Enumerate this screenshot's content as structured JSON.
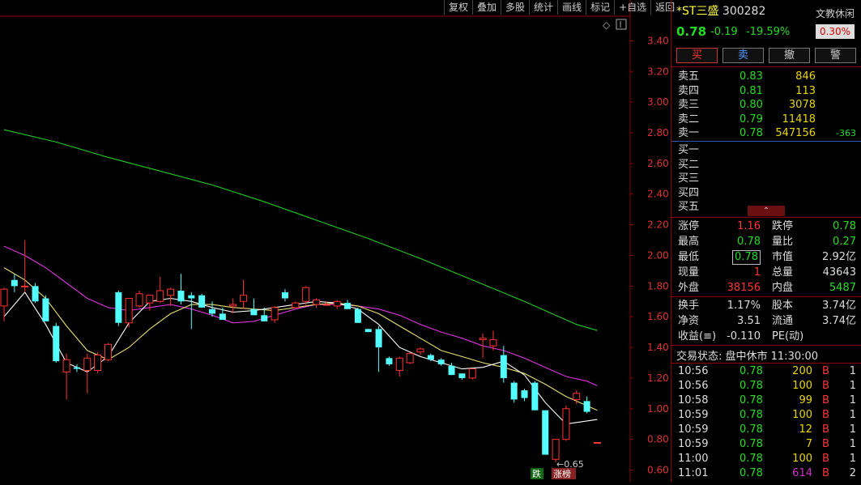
{
  "colors": {
    "up": "#ff3333",
    "down": "#54ffff",
    "ma5": "#ffffff",
    "ma10": "#e8e070",
    "ma20": "#dd33dd",
    "ma60": "#22cc22",
    "axis": "#8b0000"
  },
  "toolbar": [
    "复权",
    "叠加",
    "多股",
    "统计",
    "画线",
    "标记",
    "+自选",
    "返回"
  ],
  "chart": {
    "y_ticks": [
      "3.40",
      "3.20",
      "3.00",
      "2.80",
      "2.60",
      "2.40",
      "2.20",
      "2.00",
      "1.80",
      "1.60",
      "1.40",
      "1.20",
      "1.00",
      "0.80",
      "0.60"
    ],
    "low_label": "←0.65",
    "tag_down": "跌",
    "tag_limit": "涨榜",
    "corner_icon": "diamond-icon"
  },
  "chart_data": {
    "type": "candlestick",
    "ylim": [
      0.55,
      3.55
    ],
    "candles": [
      {
        "o": 1.67,
        "h": 1.79,
        "l": 1.57,
        "c": 1.78
      },
      {
        "o": 1.84,
        "h": 1.88,
        "l": 1.76,
        "c": 1.8
      },
      {
        "o": 1.8,
        "h": 2.1,
        "l": 1.76,
        "c": 1.8
      },
      {
        "o": 1.8,
        "h": 1.82,
        "l": 1.69,
        "c": 1.7
      },
      {
        "o": 1.72,
        "h": 1.74,
        "l": 1.57,
        "c": 1.57
      },
      {
        "o": 1.54,
        "h": 1.56,
        "l": 1.3,
        "c": 1.31
      },
      {
        "o": 1.24,
        "h": 1.36,
        "l": 1.06,
        "c": 1.32
      },
      {
        "o": 1.27,
        "h": 1.29,
        "l": 1.24,
        "c": 1.26
      },
      {
        "o": 1.25,
        "h": 1.36,
        "l": 1.1,
        "c": 1.33
      },
      {
        "o": 1.25,
        "h": 1.37,
        "l": 1.23,
        "c": 1.35
      },
      {
        "o": 1.32,
        "h": 1.43,
        "l": 1.31,
        "c": 1.42
      },
      {
        "o": 1.76,
        "h": 1.77,
        "l": 1.54,
        "c": 1.56
      },
      {
        "o": 1.56,
        "h": 1.72,
        "l": 1.53,
        "c": 1.72
      },
      {
        "o": 1.67,
        "h": 1.77,
        "l": 1.66,
        "c": 1.75
      },
      {
        "o": 1.69,
        "h": 1.74,
        "l": 1.64,
        "c": 1.74
      },
      {
        "o": 1.7,
        "h": 1.86,
        "l": 1.69,
        "c": 1.77
      },
      {
        "o": 1.74,
        "h": 1.79,
        "l": 1.67,
        "c": 1.78
      },
      {
        "o": 1.77,
        "h": 1.88,
        "l": 1.68,
        "c": 1.7
      },
      {
        "o": 1.74,
        "h": 1.76,
        "l": 1.52,
        "c": 1.72
      },
      {
        "o": 1.74,
        "h": 1.75,
        "l": 1.66,
        "c": 1.66
      },
      {
        "o": 1.65,
        "h": 1.7,
        "l": 1.6,
        "c": 1.62
      },
      {
        "o": 1.62,
        "h": 1.66,
        "l": 1.58,
        "c": 1.58
      },
      {
        "o": 1.67,
        "h": 1.72,
        "l": 1.62,
        "c": 1.68
      },
      {
        "o": 1.7,
        "h": 1.84,
        "l": 1.65,
        "c": 1.74
      },
      {
        "o": 1.65,
        "h": 1.72,
        "l": 1.61,
        "c": 1.61
      },
      {
        "o": 1.61,
        "h": 1.66,
        "l": 1.57,
        "c": 1.57
      },
      {
        "o": 1.58,
        "h": 1.67,
        "l": 1.56,
        "c": 1.66
      },
      {
        "o": 1.76,
        "h": 1.78,
        "l": 1.7,
        "c": 1.72
      },
      {
        "o": 1.66,
        "h": 1.7,
        "l": 1.66,
        "c": 1.69
      },
      {
        "o": 1.7,
        "h": 1.8,
        "l": 1.67,
        "c": 1.79
      },
      {
        "o": 1.68,
        "h": 1.72,
        "l": 1.66,
        "c": 1.71
      },
      {
        "o": 1.68,
        "h": 1.7,
        "l": 1.67,
        "c": 1.68
      },
      {
        "o": 1.67,
        "h": 1.71,
        "l": 1.65,
        "c": 1.7
      },
      {
        "o": 1.69,
        "h": 1.71,
        "l": 1.65,
        "c": 1.65
      },
      {
        "o": 1.65,
        "h": 1.66,
        "l": 1.56,
        "c": 1.56
      },
      {
        "o": 1.52,
        "h": 1.52,
        "l": 1.5,
        "c": 1.5
      },
      {
        "o": 1.52,
        "h": 1.54,
        "l": 1.24,
        "c": 1.4
      },
      {
        "o": 1.33,
        "h": 1.34,
        "l": 1.28,
        "c": 1.29
      },
      {
        "o": 1.25,
        "h": 1.34,
        "l": 1.21,
        "c": 1.33
      },
      {
        "o": 1.3,
        "h": 1.37,
        "l": 1.29,
        "c": 1.36
      },
      {
        "o": 1.37,
        "h": 1.4,
        "l": 1.35,
        "c": 1.39
      },
      {
        "o": 1.35,
        "h": 1.36,
        "l": 1.31,
        "c": 1.32
      },
      {
        "o": 1.32,
        "h": 1.33,
        "l": 1.28,
        "c": 1.29
      },
      {
        "o": 1.28,
        "h": 1.3,
        "l": 1.22,
        "c": 1.22
      },
      {
        "o": 1.23,
        "h": 1.23,
        "l": 1.19,
        "c": 1.2
      },
      {
        "o": 1.2,
        "h": 1.26,
        "l": 1.19,
        "c": 1.26
      },
      {
        "o": 1.45,
        "h": 1.49,
        "l": 1.33,
        "c": 1.46
      },
      {
        "o": 1.41,
        "h": 1.51,
        "l": 1.38,
        "c": 1.45
      },
      {
        "o": 1.35,
        "h": 1.41,
        "l": 1.17,
        "c": 1.2
      },
      {
        "o": 1.17,
        "h": 1.18,
        "l": 1.04,
        "c": 1.06
      },
      {
        "o": 1.12,
        "h": 1.13,
        "l": 1.05,
        "c": 1.07
      },
      {
        "o": 1.17,
        "h": 1.18,
        "l": 0.99,
        "c": 0.99
      },
      {
        "o": 0.99,
        "h": 0.99,
        "l": 0.7,
        "c": 0.7
      },
      {
        "o": 0.67,
        "h": 0.8,
        "l": 0.65,
        "c": 0.8
      },
      {
        "o": 0.8,
        "h": 1.02,
        "l": 0.79,
        "c": 1.0
      },
      {
        "o": 1.06,
        "h": 1.12,
        "l": 1.03,
        "c": 1.1
      },
      {
        "o": 1.05,
        "h": 1.08,
        "l": 0.97,
        "c": 0.98
      },
      {
        "o": 0.78,
        "h": 0.78,
        "l": 0.78,
        "c": 0.78
      }
    ],
    "ma5": [
      [
        0,
        1.6
      ],
      [
        2,
        1.76
      ],
      [
        4,
        1.55
      ],
      [
        6,
        1.3
      ],
      [
        8,
        1.24
      ],
      [
        10,
        1.34
      ],
      [
        12,
        1.56
      ],
      [
        14,
        1.7
      ],
      [
        16,
        1.72
      ],
      [
        18,
        1.7
      ],
      [
        20,
        1.66
      ],
      [
        22,
        1.63
      ],
      [
        24,
        1.64
      ],
      [
        26,
        1.66
      ],
      [
        28,
        1.68
      ],
      [
        30,
        1.7
      ],
      [
        32,
        1.69
      ],
      [
        34,
        1.65
      ],
      [
        36,
        1.55
      ],
      [
        38,
        1.4
      ],
      [
        40,
        1.34
      ],
      [
        42,
        1.3
      ],
      [
        44,
        1.26
      ],
      [
        46,
        1.27
      ],
      [
        48,
        1.31
      ],
      [
        50,
        1.22
      ],
      [
        52,
        1.04
      ],
      [
        54,
        0.9
      ],
      [
        56,
        0.92
      ],
      [
        57,
        0.93
      ]
    ],
    "ma10": [
      [
        0,
        1.92
      ],
      [
        2,
        1.84
      ],
      [
        4,
        1.72
      ],
      [
        6,
        1.54
      ],
      [
        8,
        1.38
      ],
      [
        10,
        1.32
      ],
      [
        12,
        1.4
      ],
      [
        14,
        1.52
      ],
      [
        16,
        1.62
      ],
      [
        18,
        1.68
      ],
      [
        20,
        1.68
      ],
      [
        22,
        1.66
      ],
      [
        24,
        1.65
      ],
      [
        26,
        1.64
      ],
      [
        28,
        1.66
      ],
      [
        30,
        1.68
      ],
      [
        32,
        1.69
      ],
      [
        34,
        1.67
      ],
      [
        36,
        1.62
      ],
      [
        38,
        1.54
      ],
      [
        40,
        1.46
      ],
      [
        42,
        1.38
      ],
      [
        44,
        1.34
      ],
      [
        46,
        1.3
      ],
      [
        48,
        1.27
      ],
      [
        50,
        1.23
      ],
      [
        52,
        1.16
      ],
      [
        54,
        1.08
      ],
      [
        56,
        1.02
      ],
      [
        57,
        0.99
      ]
    ],
    "ma20": [
      [
        0,
        2.06
      ],
      [
        2,
        2.0
      ],
      [
        4,
        1.92
      ],
      [
        6,
        1.82
      ],
      [
        8,
        1.72
      ],
      [
        10,
        1.66
      ],
      [
        12,
        1.64
      ],
      [
        14,
        1.66
      ],
      [
        16,
        1.68
      ],
      [
        18,
        1.65
      ],
      [
        20,
        1.61
      ],
      [
        22,
        1.56
      ],
      [
        24,
        1.57
      ],
      [
        26,
        1.61
      ],
      [
        28,
        1.65
      ],
      [
        30,
        1.68
      ],
      [
        32,
        1.68
      ],
      [
        34,
        1.67
      ],
      [
        36,
        1.65
      ],
      [
        38,
        1.61
      ],
      [
        40,
        1.55
      ],
      [
        42,
        1.5
      ],
      [
        44,
        1.46
      ],
      [
        46,
        1.41
      ],
      [
        48,
        1.38
      ],
      [
        50,
        1.33
      ],
      [
        52,
        1.27
      ],
      [
        54,
        1.21
      ],
      [
        56,
        1.18
      ],
      [
        57,
        1.15
      ]
    ],
    "ma60": [
      [
        0,
        2.82
      ],
      [
        5,
        2.74
      ],
      [
        10,
        2.64
      ],
      [
        15,
        2.55
      ],
      [
        20,
        2.46
      ],
      [
        25,
        2.35
      ],
      [
        30,
        2.23
      ],
      [
        35,
        2.11
      ],
      [
        40,
        1.98
      ],
      [
        45,
        1.84
      ],
      [
        50,
        1.7
      ],
      [
        55,
        1.55
      ],
      [
        57,
        1.51
      ]
    ]
  },
  "stock": {
    "name": "*ST三盛",
    "code": "300282",
    "status": "文教休闲",
    "price": "0.78",
    "change": "-0.19",
    "pct": "-19.59%",
    "badge": "0.30%"
  },
  "trade_buttons": [
    "买",
    "卖",
    "撤",
    "警"
  ],
  "asks": [
    {
      "label": "卖五",
      "price": "0.83",
      "vol": "846",
      "diff": ""
    },
    {
      "label": "卖四",
      "price": "0.81",
      "vol": "113",
      "diff": ""
    },
    {
      "label": "卖三",
      "price": "0.80",
      "vol": "3078",
      "diff": ""
    },
    {
      "label": "卖二",
      "price": "0.79",
      "vol": "11418",
      "diff": ""
    },
    {
      "label": "卖一",
      "price": "0.78",
      "vol": "547156",
      "diff": "-363"
    }
  ],
  "bids": [
    "买一",
    "买二",
    "买三",
    "买四",
    "买五"
  ],
  "stats": [
    {
      "l1": "涨停",
      "v1": "1.16",
      "c1": "red",
      "l2": "跌停",
      "v2": "0.78",
      "c2": "green"
    },
    {
      "l1": "最高",
      "v1": "0.78",
      "c1": "green",
      "l2": "量比",
      "v2": "0.27",
      "c2": "green"
    },
    {
      "l1": "最低",
      "v1": "0.78",
      "c1": "green",
      "l2": "市值",
      "v2": "2.92亿",
      "c2": "white"
    },
    {
      "l1": "现量",
      "v1": "1",
      "c1": "red",
      "l2": "总量",
      "v2": "43643",
      "c2": "white"
    },
    {
      "l1": "外盘",
      "v1": "38156",
      "c1": "red",
      "l2": "内盘",
      "v2": "5487",
      "c2": "green"
    }
  ],
  "stats2": [
    {
      "l1": "换手",
      "v1": "1.17%",
      "l2": "股本",
      "v2": "3.74亿"
    },
    {
      "l1": "净资",
      "v1": "3.51",
      "l2": "流通",
      "v2": "3.74亿"
    },
    {
      "l1": "收益(≡)",
      "v1": "-0.110",
      "l2": "PE(动)",
      "v2": ""
    }
  ],
  "trade_status": "交易状态: 盘中休市 11:30:00",
  "ticks": [
    {
      "t": "10:56",
      "p": "0.78",
      "v": "200",
      "vc": "yellow",
      "bs": "B",
      "n": "1"
    },
    {
      "t": "10:56",
      "p": "0.78",
      "v": "100",
      "vc": "yellow",
      "bs": "B",
      "n": "1"
    },
    {
      "t": "10:58",
      "p": "0.78",
      "v": "99",
      "vc": "yellow",
      "bs": "B",
      "n": "1"
    },
    {
      "t": "10:59",
      "p": "0.78",
      "v": "100",
      "vc": "yellow",
      "bs": "B",
      "n": "1"
    },
    {
      "t": "10:59",
      "p": "0.78",
      "v": "12",
      "vc": "yellow",
      "bs": "B",
      "n": "1"
    },
    {
      "t": "10:59",
      "p": "0.78",
      "v": "7",
      "vc": "yellow",
      "bs": "B",
      "n": "1"
    },
    {
      "t": "11:00",
      "p": "0.78",
      "v": "100",
      "vc": "yellow",
      "bs": "B",
      "n": "1"
    },
    {
      "t": "11:01",
      "p": "0.78",
      "v": "614",
      "vc": "magenta",
      "bs": "B",
      "n": "2"
    }
  ]
}
